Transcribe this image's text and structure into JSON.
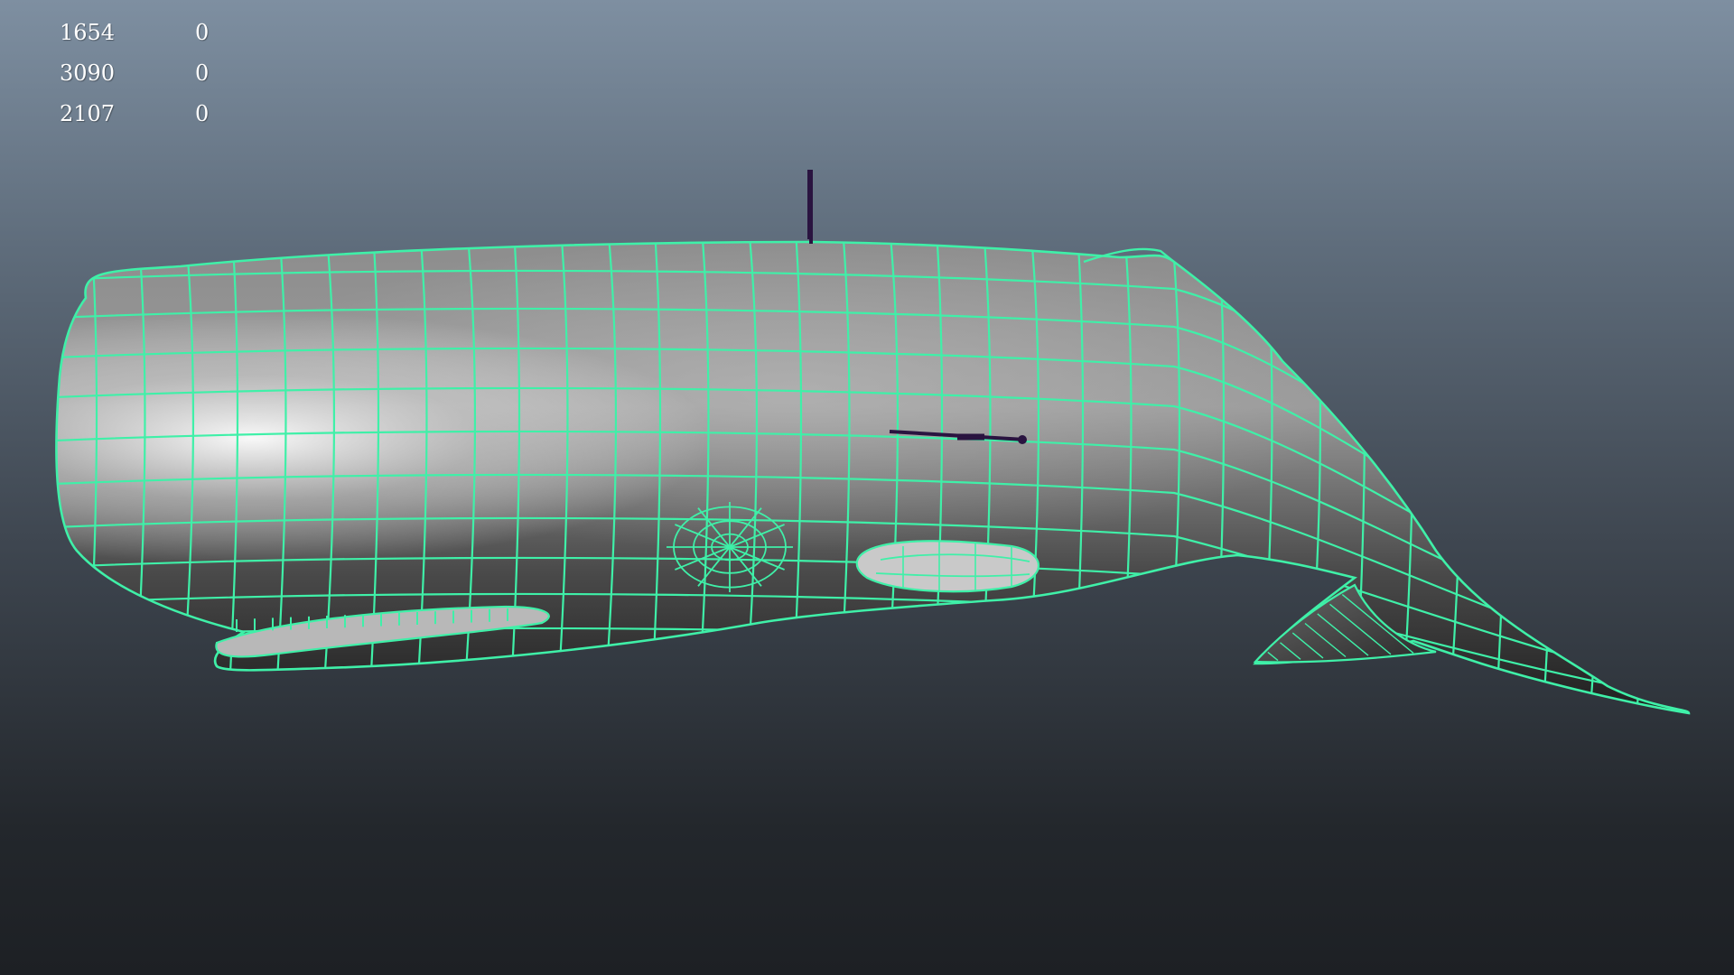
{
  "viewport": {
    "background_top": "#7e8fa1",
    "background_bottom": "#1d2024",
    "wireframe_color": "#3ff0a8",
    "manipulator_color": "#2a1440"
  },
  "hud": {
    "rows": [
      {
        "value": "1654",
        "count": "0"
      },
      {
        "value": "3090",
        "count": "0"
      },
      {
        "value": "2107",
        "count": "0"
      }
    ]
  }
}
